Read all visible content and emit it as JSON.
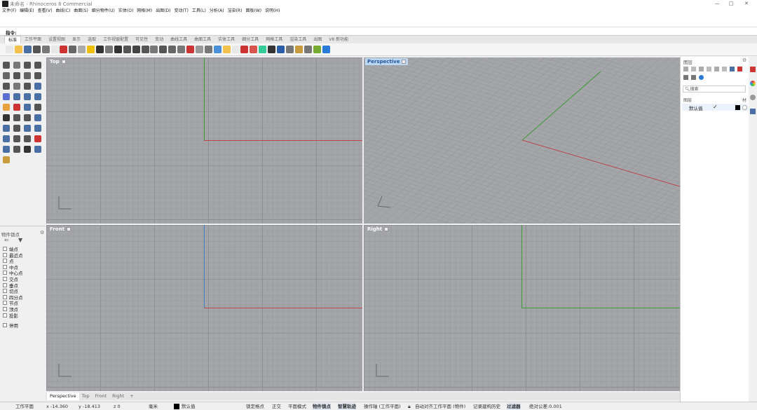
{
  "window": {
    "title": "未命名 - Rhinoceros 8 Commercial",
    "controls": [
      "—",
      "□",
      "✕"
    ]
  },
  "menubar": [
    "文件(F)",
    "编辑(E)",
    "查看(V)",
    "曲线(C)",
    "曲面(S)",
    "细分物件(U)",
    "实体(O)",
    "网格(M)",
    "出图(D)",
    "变动(T)",
    "工具(L)",
    "分析(A)",
    "渲染(R)",
    "面板(W)",
    "说明(H)"
  ],
  "command": {
    "label": "指令:"
  },
  "toolbar_tabs": [
    {
      "label": "标准",
      "active": true
    },
    {
      "label": "工作平面"
    },
    {
      "label": "设置视图"
    },
    {
      "label": "显示"
    },
    {
      "label": "选取"
    },
    {
      "label": "工作视窗配置"
    },
    {
      "label": "可见性"
    },
    {
      "label": "变动"
    },
    {
      "label": "曲线工具"
    },
    {
      "label": "曲面工具"
    },
    {
      "label": "实体工具"
    },
    {
      "label": "细分工具"
    },
    {
      "label": "网格工具"
    },
    {
      "label": "渲染工具"
    },
    {
      "label": "出图"
    },
    {
      "label": "V8 新功能"
    }
  ],
  "toolbar_icons": [
    "#e8e8e8",
    "#f2c14e",
    "#4a6fa5",
    "#555",
    "#777",
    "#e8e8e8",
    "#c33",
    "#666",
    "#aaa",
    "#f0c000",
    "#333",
    "#777",
    "#333",
    "#555",
    "#444",
    "#555",
    "#777",
    "#555",
    "#666",
    "#777",
    "#c33",
    "#999",
    "#777",
    "#4a90d9",
    "#f2c14e",
    "#e8e8e8",
    "#c33",
    "#d9534f",
    "#3c9",
    "#333",
    "#2a5ca8",
    "#777",
    "#c89b3c",
    "#777",
    "#7a3",
    "#2a7ad9"
  ],
  "left_tool_colors": [
    "#555",
    "#777",
    "#555",
    "#555",
    "#666",
    "#555",
    "#666",
    "#555",
    "#555",
    "#777",
    "#555",
    "#4a6fa5",
    "#5b6fd1",
    "#4a6fa5",
    "#4a6fa5",
    "#4a6fa5",
    "#e8a040",
    "#c33",
    "#4a6fa5",
    "#555",
    "#333",
    "#555",
    "#555",
    "#4a6fa5",
    "#4a6fa5",
    "#555",
    "#4a6fa5",
    "#4a6fa5",
    "#4a6fa5",
    "#555",
    "#555",
    "#c33",
    "#4a6fa5",
    "#555",
    "#333",
    "#4a6fa5",
    "#c89b3c"
  ],
  "osnap": {
    "title": "物件锁点",
    "items": [
      "端点",
      "最近点",
      "点",
      "中点",
      "中心点",
      "交点",
      "垂点",
      "切点",
      "四分点",
      "节点",
      "顶点",
      "投影"
    ],
    "disable": "停用"
  },
  "viewports": {
    "top": "Top",
    "perspective": "Perspective",
    "front": "Front",
    "right": "Right"
  },
  "layers_panel": {
    "title": "图层",
    "search_placeholder": "搜索",
    "column_header": "图层",
    "column_header_right": "材",
    "default_layer": "默认值",
    "check": "✓"
  },
  "viewport_tabs": [
    {
      "label": "Perspective",
      "active": true
    },
    {
      "label": "Top"
    },
    {
      "label": "Front"
    },
    {
      "label": "Right"
    },
    {
      "label": "+"
    }
  ],
  "status": {
    "cplane": "工作平面",
    "x": "x -14.360",
    "y": "y -18.413",
    "z": "z 0",
    "unit": "毫米",
    "layer": "默认值",
    "lock_grid": "锁定格点",
    "ortho": "正交",
    "planar": "平面模式",
    "osnap": "物件锁点",
    "smarttrack": "智慧轨迹",
    "gumball": "操作轴 (工作平面)",
    "autoalign": "自动对齐工作平面 (物件)",
    "history": "记录建构历史",
    "filter": "过滤器",
    "tolerance": "绝对公差:0.001"
  }
}
